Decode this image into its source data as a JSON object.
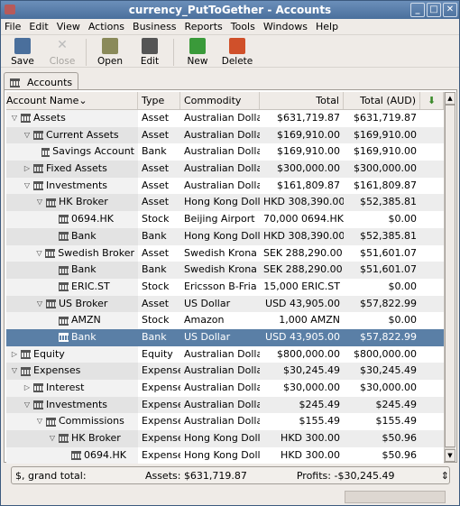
{
  "window": {
    "title": "currency_PutToGether - Accounts",
    "controls": [
      "_",
      "□",
      "✕"
    ]
  },
  "menu": [
    "File",
    "Edit",
    "View",
    "Actions",
    "Business",
    "Reports",
    "Tools",
    "Windows",
    "Help"
  ],
  "toolbar": [
    {
      "label": "Save",
      "icon": "save-icon",
      "enabled": true,
      "color": "#4a6f9c"
    },
    {
      "label": "Close",
      "icon": "close-icon",
      "enabled": false,
      "color": "#bbbbbb"
    },
    {
      "label": "Open",
      "icon": "open-account-icon",
      "enabled": true,
      "color": "#8a8a5a"
    },
    {
      "label": "Edit",
      "icon": "edit-account-icon",
      "enabled": true,
      "color": "#555555"
    },
    {
      "label": "New",
      "icon": "new-account-icon",
      "enabled": true,
      "color": "#3a9a3a"
    },
    {
      "label": "Delete",
      "icon": "delete-account-icon",
      "enabled": true,
      "color": "#d0502a"
    }
  ],
  "tab": {
    "label": "Accounts"
  },
  "columns": [
    "Account Name",
    "Type",
    "Commodity",
    "Total",
    "Total (AUD)"
  ],
  "rows": [
    {
      "name": "Assets",
      "depth": 0,
      "exp": "open",
      "type": "Asset",
      "commodity": "Australian Dollar",
      "total": "$631,719.87",
      "aud": "$631,719.87"
    },
    {
      "name": "Current Assets",
      "depth": 1,
      "exp": "open",
      "type": "Asset",
      "commodity": "Australian Dollar",
      "total": "$169,910.00",
      "aud": "$169,910.00"
    },
    {
      "name": "Savings Account",
      "depth": 2,
      "exp": "",
      "type": "Bank",
      "commodity": "Australian Dollar",
      "total": "$169,910.00",
      "aud": "$169,910.00"
    },
    {
      "name": "Fixed Assets",
      "depth": 1,
      "exp": "closed",
      "type": "Asset",
      "commodity": "Australian Dollar",
      "total": "$300,000.00",
      "aud": "$300,000.00"
    },
    {
      "name": "Investments",
      "depth": 1,
      "exp": "open",
      "type": "Asset",
      "commodity": "Australian Dollar",
      "total": "$161,809.87",
      "aud": "$161,809.87"
    },
    {
      "name": "HK Broker",
      "depth": 2,
      "exp": "open",
      "type": "Asset",
      "commodity": "Hong Kong Dollar",
      "total": "HKD 308,390.00",
      "aud": "$52,385.81"
    },
    {
      "name": "0694.HK",
      "depth": 3,
      "exp": "",
      "type": "Stock",
      "commodity": "Beijing Airport",
      "total": "70,000 0694.HK",
      "aud": "$0.00"
    },
    {
      "name": "Bank",
      "depth": 3,
      "exp": "",
      "type": "Bank",
      "commodity": "Hong Kong Dollar",
      "total": "HKD 308,390.00",
      "aud": "$52,385.81"
    },
    {
      "name": "Swedish Broker",
      "depth": 2,
      "exp": "open",
      "type": "Asset",
      "commodity": "Swedish Krona",
      "total": "SEK 288,290.00",
      "aud": "$51,601.07"
    },
    {
      "name": "Bank",
      "depth": 3,
      "exp": "",
      "type": "Bank",
      "commodity": "Swedish Krona",
      "total": "SEK 288,290.00",
      "aud": "$51,601.07"
    },
    {
      "name": "ERIC.ST",
      "depth": 3,
      "exp": "",
      "type": "Stock",
      "commodity": "Ericsson B-Fria",
      "total": "15,000 ERIC.ST",
      "aud": "$0.00"
    },
    {
      "name": "US Broker",
      "depth": 2,
      "exp": "open",
      "type": "Asset",
      "commodity": "US Dollar",
      "total": "USD 43,905.00",
      "aud": "$57,822.99"
    },
    {
      "name": "AMZN",
      "depth": 3,
      "exp": "",
      "type": "Stock",
      "commodity": "Amazon",
      "total": "1,000 AMZN",
      "aud": "$0.00"
    },
    {
      "name": "Bank",
      "depth": 3,
      "exp": "",
      "type": "Bank",
      "commodity": "US Dollar",
      "total": "USD 43,905.00",
      "aud": "$57,822.99",
      "selected": true
    },
    {
      "name": "Equity",
      "depth": 0,
      "exp": "closed",
      "type": "Equity",
      "commodity": "Australian Dollar",
      "total": "$800,000.00",
      "aud": "$800,000.00"
    },
    {
      "name": "Expenses",
      "depth": 0,
      "exp": "open",
      "type": "Expense",
      "commodity": "Australian Dollar",
      "total": "$30,245.49",
      "aud": "$30,245.49"
    },
    {
      "name": "Interest",
      "depth": 1,
      "exp": "closed",
      "type": "Expense",
      "commodity": "Australian Dollar",
      "total": "$30,000.00",
      "aud": "$30,000.00"
    },
    {
      "name": "Investments",
      "depth": 1,
      "exp": "open",
      "type": "Expense",
      "commodity": "Australian Dollar",
      "total": "$245.49",
      "aud": "$245.49"
    },
    {
      "name": "Commissions",
      "depth": 2,
      "exp": "open",
      "type": "Expense",
      "commodity": "Australian Dollar",
      "total": "$155.49",
      "aud": "$155.49"
    },
    {
      "name": "HK Broker",
      "depth": 3,
      "exp": "open",
      "type": "Expense",
      "commodity": "Hong Kong Dollar",
      "total": "HKD 300.00",
      "aud": "$50.96"
    },
    {
      "name": "0694.HK",
      "depth": 4,
      "exp": "",
      "type": "Expense",
      "commodity": "Hong Kong Dollar",
      "total": "HKD 300.00",
      "aud": "$50.96"
    }
  ],
  "summary": {
    "label": "$, grand total:",
    "assets": "Assets: $631,719.87",
    "profits": "Profits: -$30,245.49"
  }
}
